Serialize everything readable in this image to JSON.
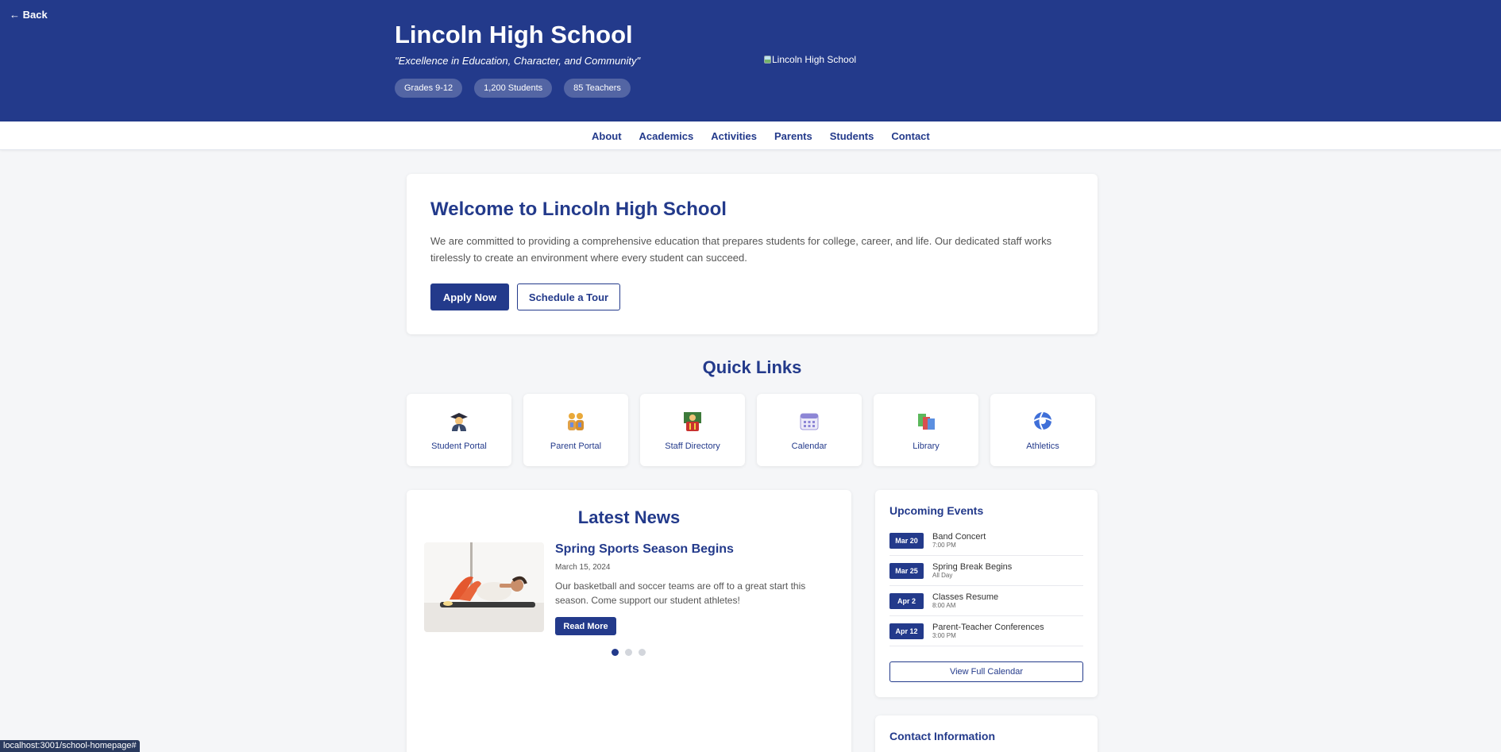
{
  "header": {
    "back_label": "← Back",
    "school_name": "Lincoln High School",
    "motto": "\"Excellence in Education, Character, and Community\"",
    "stats": [
      "Grades 9-12",
      "1,200 Students",
      "85 Teachers"
    ],
    "logo_alt": "Lincoln High School"
  },
  "nav": {
    "items": [
      "About",
      "Academics",
      "Activities",
      "Parents",
      "Students",
      "Contact"
    ]
  },
  "welcome": {
    "title": "Welcome to Lincoln High School",
    "text": "We are committed to providing a comprehensive education that prepares students for college, career, and life. Our dedicated staff works tirelessly to create an environment where every student can succeed.",
    "apply_label": "Apply Now",
    "tour_label": "Schedule a Tour"
  },
  "quick_links": {
    "title": "Quick Links",
    "items": [
      {
        "label": "Student Portal",
        "icon": "graduate-icon"
      },
      {
        "label": "Parent Portal",
        "icon": "family-icon"
      },
      {
        "label": "Staff Directory",
        "icon": "teacher-icon"
      },
      {
        "label": "Calendar",
        "icon": "calendar-icon"
      },
      {
        "label": "Library",
        "icon": "books-icon"
      },
      {
        "label": "Athletics",
        "icon": "ball-icon"
      }
    ]
  },
  "news": {
    "title": "Latest News",
    "headline": "Spring Sports Season Begins",
    "date": "March 15, 2024",
    "summary": "Our basketball and soccer teams are off to a great start this season. Come support our student athletes!",
    "read_more_label": "Read More",
    "slide_count": 3,
    "active_slide": 1
  },
  "events": {
    "title": "Upcoming Events",
    "items": [
      {
        "date": "Mar 20",
        "name": "Band Concert",
        "time": "7:00 PM"
      },
      {
        "date": "Mar 25",
        "name": "Spring Break Begins",
        "time": "All Day"
      },
      {
        "date": "Apr 2",
        "name": "Classes Resume",
        "time": "8:00 AM"
      },
      {
        "date": "Apr 12",
        "name": "Parent-Teacher Conferences",
        "time": "3:00 PM"
      }
    ],
    "view_all_label": "View Full Calendar"
  },
  "contact": {
    "title": "Contact Information"
  },
  "status_bar": {
    "url": "localhost:3001/school-homepage#"
  },
  "colors": {
    "primary": "#233a8b",
    "background": "#f5f6f8"
  }
}
